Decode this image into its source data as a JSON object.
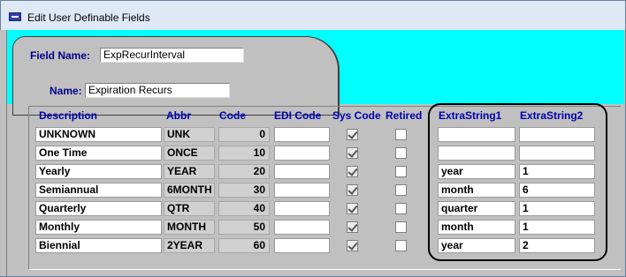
{
  "window": {
    "title": "Edit User Definable Fields",
    "icon": "app-icon"
  },
  "field_name": {
    "label": "Field Name:",
    "value": "ExpRecurInterval"
  },
  "name": {
    "label": "Name:",
    "value": "Expiration Recurs"
  },
  "headers": {
    "description": "Description",
    "abbr": "Abbr",
    "code": "Code",
    "edi_code": "EDI Code",
    "sys_code": "Sys Code",
    "retired": "Retired",
    "extra1": "ExtraString1",
    "extra2": "ExtraString2"
  },
  "rows": [
    {
      "description": "UNKNOWN",
      "abbr": "UNK",
      "code": "0",
      "edi_code": "",
      "sys_code": true,
      "retired": false,
      "extra1": "",
      "extra2": ""
    },
    {
      "description": "One Time",
      "abbr": "ONCE",
      "code": "10",
      "edi_code": "",
      "sys_code": true,
      "retired": false,
      "extra1": "",
      "extra2": ""
    },
    {
      "description": "Yearly",
      "abbr": "YEAR",
      "code": "20",
      "edi_code": "",
      "sys_code": true,
      "retired": false,
      "extra1": "year",
      "extra2": "1"
    },
    {
      "description": "Semiannual",
      "abbr": "6MONTH",
      "code": "30",
      "edi_code": "",
      "sys_code": true,
      "retired": false,
      "extra1": "month",
      "extra2": "6"
    },
    {
      "description": "Quarterly",
      "abbr": "QTR",
      "code": "40",
      "edi_code": "",
      "sys_code": true,
      "retired": false,
      "extra1": "quarter",
      "extra2": "1"
    },
    {
      "description": "Monthly",
      "abbr": "MONTH",
      "code": "50",
      "edi_code": "",
      "sys_code": true,
      "retired": false,
      "extra1": "month",
      "extra2": "1"
    },
    {
      "description": "Biennial",
      "abbr": "2YEAR",
      "code": "60",
      "edi_code": "",
      "sys_code": true,
      "retired": false,
      "extra1": "year",
      "extra2": "2"
    }
  ],
  "colors": {
    "header_text": "#0000b0",
    "label_text": "#00008b",
    "cyan_bg": "#00ffff",
    "panel_bg": "#c0c0c0"
  }
}
